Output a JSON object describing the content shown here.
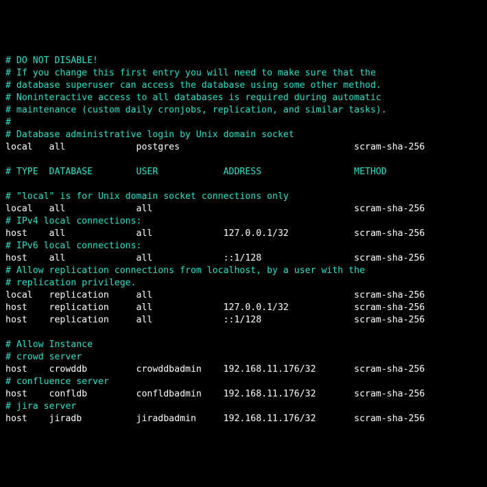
{
  "colors": {
    "bg": "#000000",
    "comment": "#2ee0c8",
    "text": "#ffffff"
  },
  "lines": [
    {
      "cls": "c",
      "text": "# DO NOT DISABLE!"
    },
    {
      "cls": "c",
      "text": "# If you change this first entry you will need to make sure that the"
    },
    {
      "cls": "c",
      "text": "# database superuser can access the database using some other method."
    },
    {
      "cls": "c",
      "text": "# Noninteractive access to all databases is required during automatic"
    },
    {
      "cls": "c",
      "text": "# maintenance (custom daily cronjobs, replication, and similar tasks)."
    },
    {
      "cls": "c",
      "text": "#"
    },
    {
      "cls": "c",
      "text": "# Database administrative login by Unix domain socket"
    },
    {
      "cls": "w",
      "text": "local   all             postgres                                scram-sha-256"
    },
    {
      "cls": "w",
      "text": " "
    },
    {
      "cls": "c",
      "text": "# TYPE  DATABASE        USER            ADDRESS                 METHOD"
    },
    {
      "cls": "w",
      "text": " "
    },
    {
      "cls": "c",
      "text": "# \"local\" is for Unix domain socket connections only"
    },
    {
      "cls": "w",
      "text": "local   all             all                                     scram-sha-256"
    },
    {
      "cls": "c",
      "text": "# IPv4 local connections:"
    },
    {
      "cls": "w",
      "text": "host    all             all             127.0.0.1/32            scram-sha-256"
    },
    {
      "cls": "c",
      "text": "# IPv6 local connections:"
    },
    {
      "cls": "w",
      "text": "host    all             all             ::1/128                 scram-sha-256"
    },
    {
      "cls": "c",
      "text": "# Allow replication connections from localhost, by a user with the"
    },
    {
      "cls": "c",
      "text": "# replication privilege."
    },
    {
      "cls": "w",
      "text": "local   replication     all                                     scram-sha-256"
    },
    {
      "cls": "w",
      "text": "host    replication     all             127.0.0.1/32            scram-sha-256"
    },
    {
      "cls": "w",
      "text": "host    replication     all             ::1/128                 scram-sha-256"
    },
    {
      "cls": "w",
      "text": " "
    },
    {
      "cls": "c",
      "text": "# Allow Instance"
    },
    {
      "cls": "c",
      "text": "# crowd server"
    },
    {
      "cls": "w",
      "text": "host    crowddb         crowddbadmin    192.168.11.176/32       scram-sha-256"
    },
    {
      "cls": "c",
      "text": "# confluence server"
    },
    {
      "cls": "w",
      "text": "host    confldb         confldbadmin    192.168.11.176/32       scram-sha-256"
    },
    {
      "cls": "c",
      "text": "# jira server"
    },
    {
      "cls": "w",
      "text": "host    jiradb          jiradbadmin     192.168.11.176/32       scram-sha-256"
    }
  ]
}
